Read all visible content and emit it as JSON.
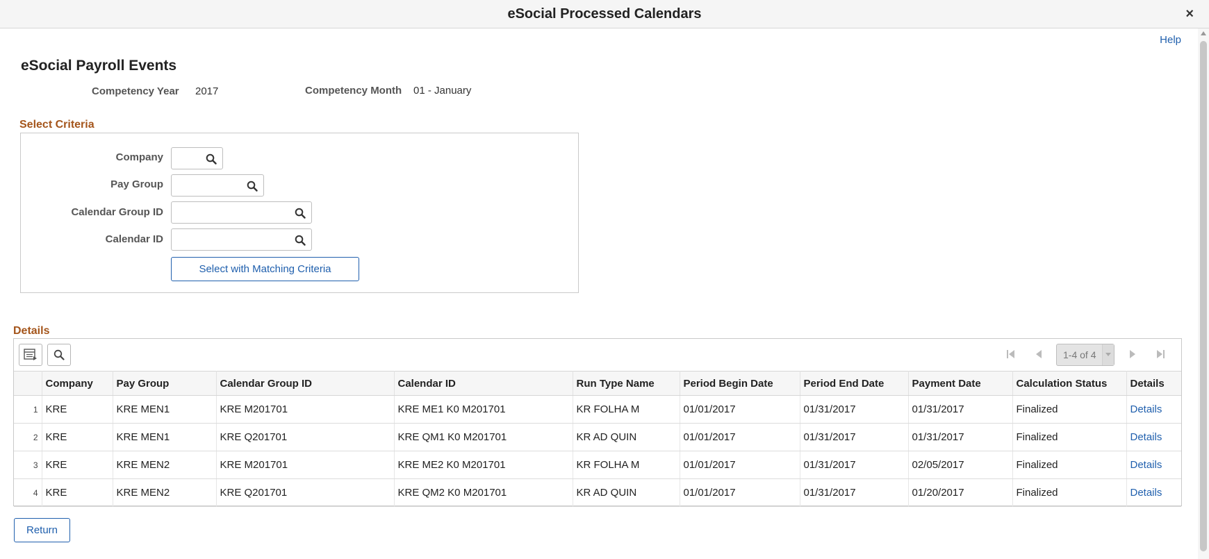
{
  "window": {
    "title": "eSocial Processed Calendars",
    "close_label": "×"
  },
  "header": {
    "help_label": "Help",
    "page_title": "eSocial Payroll Events"
  },
  "competency": {
    "year_label": "Competency Year",
    "year_value": "2017",
    "month_label": "Competency Month",
    "month_value": "01 - January"
  },
  "criteria": {
    "section_title": "Select Criteria",
    "company_label": "Company",
    "paygroup_label": "Pay Group",
    "calgroup_label": "Calendar Group ID",
    "calid_label": "Calendar ID",
    "company_value": "",
    "paygroup_value": "",
    "calgroup_value": "",
    "calid_value": "",
    "button_label": "Select with Matching Criteria"
  },
  "details": {
    "section_title": "Details",
    "pager_text": "1-4 of 4",
    "columns": [
      "",
      "Company",
      "Pay Group",
      "Calendar Group ID",
      "Calendar ID",
      "Run Type Name",
      "Period Begin Date",
      "Period End Date",
      "Payment Date",
      "Calculation Status",
      "Details"
    ],
    "rows": [
      {
        "n": "1",
        "company": "KRE",
        "paygroup": "KRE MEN1",
        "calgroup": "KRE M201701",
        "calid": "KRE ME1 K0 M201701",
        "runtype": "KR FOLHA M",
        "begin": "01/01/2017",
        "end": "01/31/2017",
        "payment": "01/31/2017",
        "status": "Finalized",
        "details": "Details"
      },
      {
        "n": "2",
        "company": "KRE",
        "paygroup": "KRE MEN1",
        "calgroup": "KRE Q201701",
        "calid": "KRE QM1 K0 M201701",
        "runtype": "KR AD QUIN",
        "begin": "01/01/2017",
        "end": "01/31/2017",
        "payment": "01/31/2017",
        "status": "Finalized",
        "details": "Details"
      },
      {
        "n": "3",
        "company": "KRE",
        "paygroup": "KRE MEN2",
        "calgroup": "KRE M201701",
        "calid": "KRE ME2 K0 M201701",
        "runtype": "KR FOLHA M",
        "begin": "01/01/2017",
        "end": "01/31/2017",
        "payment": "02/05/2017",
        "status": "Finalized",
        "details": "Details"
      },
      {
        "n": "4",
        "company": "KRE",
        "paygroup": "KRE MEN2",
        "calgroup": "KRE Q201701",
        "calid": "KRE QM2 K0 M201701",
        "runtype": "KR AD QUIN",
        "begin": "01/01/2017",
        "end": "01/31/2017",
        "payment": "01/20/2017",
        "status": "Finalized",
        "details": "Details"
      }
    ]
  },
  "footer": {
    "return_label": "Return"
  },
  "colors": {
    "link": "#1f5fad",
    "section_title": "#a4551b"
  }
}
